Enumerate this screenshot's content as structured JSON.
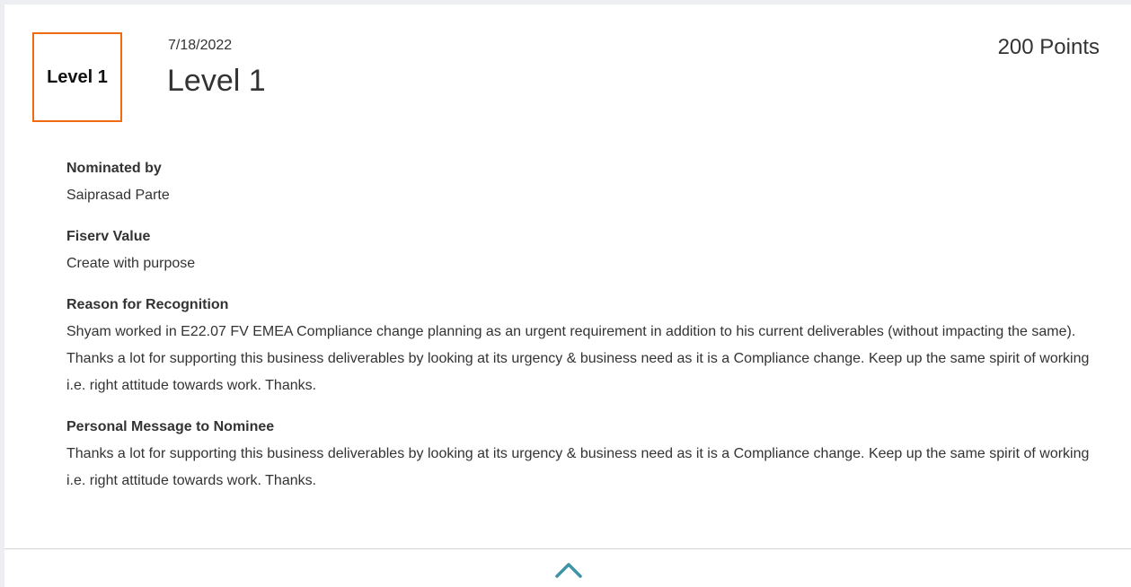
{
  "badge": {
    "label": "Level 1",
    "color": "#f06a0f"
  },
  "header": {
    "date": "7/18/2022",
    "title": "Level 1",
    "points": "200 Points"
  },
  "sections": [
    {
      "label": "Nominated by",
      "value": "Saiprasad Parte"
    },
    {
      "label": "Fiserv Value",
      "value": "Create with purpose"
    },
    {
      "label": "Reason for Recognition",
      "value": "Shyam worked in E22.07 FV EMEA Compliance change planning as an urgent requirement in addition to his current deliverables (without impacting the same). Thanks a lot for supporting this business deliverables by looking at its urgency & business need as it is a Compliance change. Keep up the same spirit of working i.e. right attitude towards work. Thanks."
    },
    {
      "label": "Personal Message to Nominee",
      "value": "Thanks a lot for supporting this business deliverables by looking at its urgency & business need as it is a Compliance change. Keep up the same spirit of working i.e. right attitude towards work. Thanks."
    }
  ],
  "collapse": {
    "icon": "chevron-up-icon",
    "color": "#3f93a6"
  }
}
